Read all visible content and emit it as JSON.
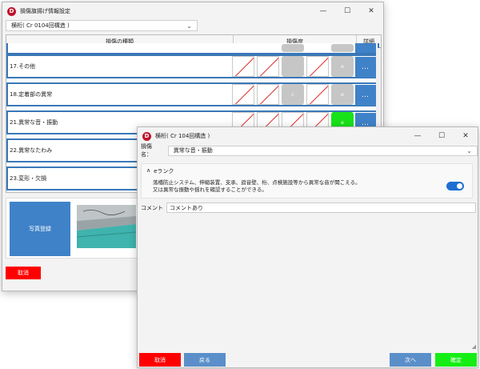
{
  "main_window": {
    "title": "損傷旗揚げ情報設定",
    "controls": {
      "minimize": "—",
      "maximize": "☐",
      "close": "✕"
    },
    "member_select": "横桁( Cr 0104回構造 )",
    "columns": {
      "type": "損傷の種類",
      "degree": "損傷度",
      "detail": "詳細"
    },
    "rows": [
      {
        "label": "17.その他",
        "grade_label": "e"
      },
      {
        "label": "18.定着部の異常",
        "grade_c": "c",
        "grade_label": "e"
      },
      {
        "label": "21.異常な音・振動",
        "grade_label": "e"
      },
      {
        "label": "22.異常なたわみ"
      },
      {
        "label": "23.変形・欠損"
      }
    ],
    "more_label": "…",
    "photo_button": "写真登録",
    "cancel_button": "取消"
  },
  "dialog": {
    "title": "横桁( Cr 104回構造 )",
    "controls": {
      "minimize": "—",
      "maximize": "☐",
      "close": "✕"
    },
    "damage_label": "損傷名：",
    "damage_value": "異常な音・振動",
    "rank_heading": "eランク",
    "rank_text_1": "落橋防止システム、伸縮装置、支承、遮音壁、桁、点検施設等から異常な音が聞こえる。",
    "rank_text_2": "又は異常な振動や揺れを確認することができる。",
    "comment_label": "コメント",
    "comment_value": "コメントあり",
    "buttons": {
      "cancel": "取消",
      "back": "戻る",
      "next": "次へ",
      "confirm": "確定"
    }
  }
}
